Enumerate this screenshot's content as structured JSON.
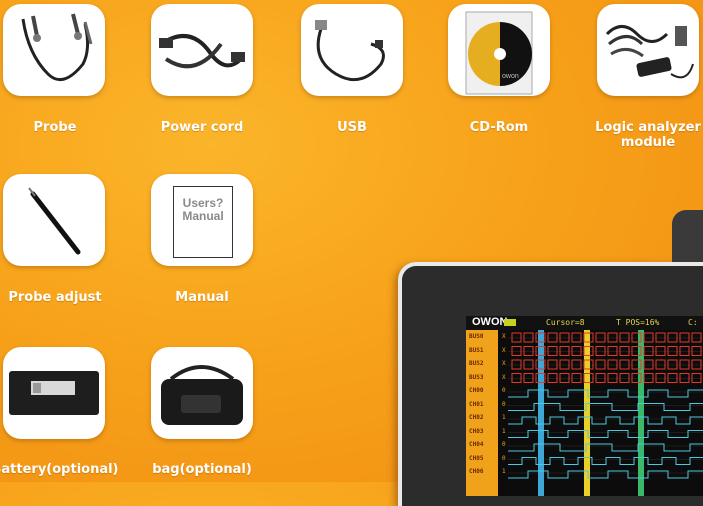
{
  "accessories": [
    {
      "label": "Probe"
    },
    {
      "label": "Power cord"
    },
    {
      "label": "USB"
    },
    {
      "label": "CD-Rom"
    },
    {
      "label": "Logic analyzer module"
    },
    {
      "label": "Probe adjust"
    },
    {
      "label": "Manual"
    },
    {
      "label": "Battery(optional)"
    },
    {
      "label": "bag(optional)"
    }
  ],
  "manual_cover_text": "Users? Manual",
  "cd_logo": "owon",
  "device_screen": {
    "brand": "OWON",
    "cursor": "Cursor=8",
    "t_pos": "T POS=16%",
    "c_text": "C:",
    "channels": [
      "BUS0",
      "BUS1",
      "BUS2",
      "BUS3",
      "CH00",
      "CH01",
      "CH02",
      "CH03",
      "CH04",
      "CH05",
      "CH06"
    ],
    "values": [
      "X",
      "X",
      "X",
      "X",
      "0",
      "0",
      "1",
      "1",
      "0",
      "0",
      "1"
    ]
  },
  "colors": {
    "background": "#f7a21a",
    "caption": "#ffffff",
    "trace_yellow": "#e8d028",
    "trace_blue": "#3fa7d6",
    "trace_green": "#3bb86a",
    "trace_red": "#e23a2a"
  }
}
